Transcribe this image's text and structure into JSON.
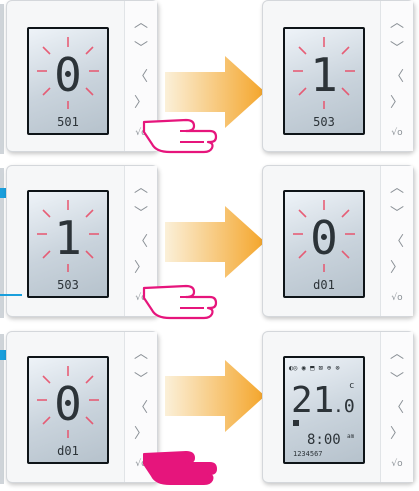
{
  "rows": [
    {
      "left": {
        "digit": "0",
        "code": "501",
        "glow": true
      },
      "right": {
        "digit": "1",
        "code": "503",
        "glow": true
      },
      "hand": "outline"
    },
    {
      "left": {
        "digit": "1",
        "code": "503",
        "glow": true
      },
      "right": {
        "digit": "0",
        "code": "d01",
        "glow": true
      },
      "hand": "outline"
    },
    {
      "left": {
        "digit": "0",
        "code": "d01",
        "glow": true
      },
      "right": {
        "temp_whole": "21",
        "temp_dec": ".0",
        "unit": "c",
        "time": "8:00",
        "ampm": "am",
        "days": "1234567",
        "status": "◐◎ ◉ ⬒ ⊠ ⊕ ⊗"
      },
      "hand": "solid"
    }
  ],
  "buttons": {
    "up": "︿",
    "down": "﹀",
    "left": "〈",
    "right": "〉",
    "ok": "√o"
  },
  "colors": {
    "arrow_gradient_start": "#fbf0d9",
    "arrow_gradient_end": "#f4a52a",
    "glow": "#e8506a",
    "hand_outline": "#e6157c",
    "hand_fill": "#e6157c",
    "blue_indicator": "#1a9fdc"
  }
}
